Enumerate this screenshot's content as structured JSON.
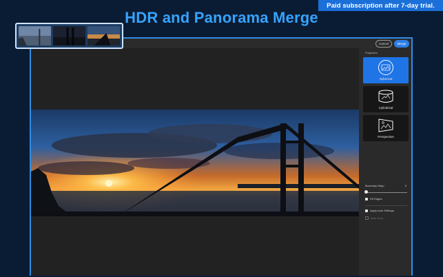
{
  "promo": {
    "text": "Paid subscription after 7-day trial."
  },
  "headline": {
    "text": "HDR and Panorama Merge"
  },
  "dialog": {
    "cancel_label": "Cancel",
    "merge_label": "Merge"
  },
  "panel": {
    "section_label": "Projection",
    "projections": [
      {
        "label": "Spherical",
        "icon": "sphere-icon",
        "selected": true
      },
      {
        "label": "Cylindrical",
        "icon": "cylinder-icon",
        "selected": false
      },
      {
        "label": "Perspective",
        "icon": "perspective-icon",
        "selected": false
      }
    ],
    "boundary_warp_label": "Boundary Warp",
    "boundary_warp_value": "0",
    "fill_edges_label": "Fill Edges",
    "fill_edges_checked": true,
    "apply_auto_label": "Apply Auto Settings",
    "apply_auto_checked": true,
    "auto_crop_label": "Auto Crop",
    "auto_crop_checked": false
  },
  "colors": {
    "accent": "#2d7ee6",
    "headline": "#36a3ff",
    "background": "#0a1c33"
  }
}
